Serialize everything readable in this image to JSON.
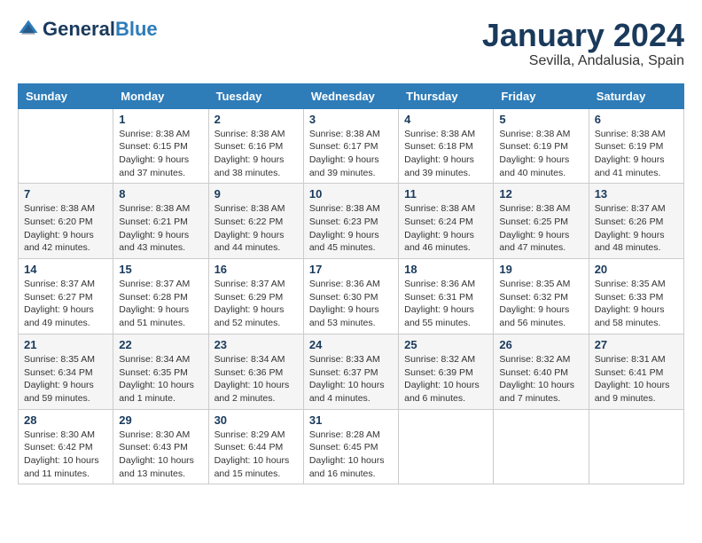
{
  "header": {
    "logo_general": "General",
    "logo_blue": "Blue",
    "month": "January 2024",
    "location": "Sevilla, Andalusia, Spain"
  },
  "days_of_week": [
    "Sunday",
    "Monday",
    "Tuesday",
    "Wednesday",
    "Thursday",
    "Friday",
    "Saturday"
  ],
  "weeks": [
    [
      {
        "day": "",
        "info": ""
      },
      {
        "day": "1",
        "info": "Sunrise: 8:38 AM\nSunset: 6:15 PM\nDaylight: 9 hours\nand 37 minutes."
      },
      {
        "day": "2",
        "info": "Sunrise: 8:38 AM\nSunset: 6:16 PM\nDaylight: 9 hours\nand 38 minutes."
      },
      {
        "day": "3",
        "info": "Sunrise: 8:38 AM\nSunset: 6:17 PM\nDaylight: 9 hours\nand 39 minutes."
      },
      {
        "day": "4",
        "info": "Sunrise: 8:38 AM\nSunset: 6:18 PM\nDaylight: 9 hours\nand 39 minutes."
      },
      {
        "day": "5",
        "info": "Sunrise: 8:38 AM\nSunset: 6:19 PM\nDaylight: 9 hours\nand 40 minutes."
      },
      {
        "day": "6",
        "info": "Sunrise: 8:38 AM\nSunset: 6:19 PM\nDaylight: 9 hours\nand 41 minutes."
      }
    ],
    [
      {
        "day": "7",
        "info": "Sunrise: 8:38 AM\nSunset: 6:20 PM\nDaylight: 9 hours\nand 42 minutes."
      },
      {
        "day": "8",
        "info": "Sunrise: 8:38 AM\nSunset: 6:21 PM\nDaylight: 9 hours\nand 43 minutes."
      },
      {
        "day": "9",
        "info": "Sunrise: 8:38 AM\nSunset: 6:22 PM\nDaylight: 9 hours\nand 44 minutes."
      },
      {
        "day": "10",
        "info": "Sunrise: 8:38 AM\nSunset: 6:23 PM\nDaylight: 9 hours\nand 45 minutes."
      },
      {
        "day": "11",
        "info": "Sunrise: 8:38 AM\nSunset: 6:24 PM\nDaylight: 9 hours\nand 46 minutes."
      },
      {
        "day": "12",
        "info": "Sunrise: 8:38 AM\nSunset: 6:25 PM\nDaylight: 9 hours\nand 47 minutes."
      },
      {
        "day": "13",
        "info": "Sunrise: 8:37 AM\nSunset: 6:26 PM\nDaylight: 9 hours\nand 48 minutes."
      }
    ],
    [
      {
        "day": "14",
        "info": "Sunrise: 8:37 AM\nSunset: 6:27 PM\nDaylight: 9 hours\nand 49 minutes."
      },
      {
        "day": "15",
        "info": "Sunrise: 8:37 AM\nSunset: 6:28 PM\nDaylight: 9 hours\nand 51 minutes."
      },
      {
        "day": "16",
        "info": "Sunrise: 8:37 AM\nSunset: 6:29 PM\nDaylight: 9 hours\nand 52 minutes."
      },
      {
        "day": "17",
        "info": "Sunrise: 8:36 AM\nSunset: 6:30 PM\nDaylight: 9 hours\nand 53 minutes."
      },
      {
        "day": "18",
        "info": "Sunrise: 8:36 AM\nSunset: 6:31 PM\nDaylight: 9 hours\nand 55 minutes."
      },
      {
        "day": "19",
        "info": "Sunrise: 8:35 AM\nSunset: 6:32 PM\nDaylight: 9 hours\nand 56 minutes."
      },
      {
        "day": "20",
        "info": "Sunrise: 8:35 AM\nSunset: 6:33 PM\nDaylight: 9 hours\nand 58 minutes."
      }
    ],
    [
      {
        "day": "21",
        "info": "Sunrise: 8:35 AM\nSunset: 6:34 PM\nDaylight: 9 hours\nand 59 minutes."
      },
      {
        "day": "22",
        "info": "Sunrise: 8:34 AM\nSunset: 6:35 PM\nDaylight: 10 hours\nand 1 minute."
      },
      {
        "day": "23",
        "info": "Sunrise: 8:34 AM\nSunset: 6:36 PM\nDaylight: 10 hours\nand 2 minutes."
      },
      {
        "day": "24",
        "info": "Sunrise: 8:33 AM\nSunset: 6:37 PM\nDaylight: 10 hours\nand 4 minutes."
      },
      {
        "day": "25",
        "info": "Sunrise: 8:32 AM\nSunset: 6:39 PM\nDaylight: 10 hours\nand 6 minutes."
      },
      {
        "day": "26",
        "info": "Sunrise: 8:32 AM\nSunset: 6:40 PM\nDaylight: 10 hours\nand 7 minutes."
      },
      {
        "day": "27",
        "info": "Sunrise: 8:31 AM\nSunset: 6:41 PM\nDaylight: 10 hours\nand 9 minutes."
      }
    ],
    [
      {
        "day": "28",
        "info": "Sunrise: 8:30 AM\nSunset: 6:42 PM\nDaylight: 10 hours\nand 11 minutes."
      },
      {
        "day": "29",
        "info": "Sunrise: 8:30 AM\nSunset: 6:43 PM\nDaylight: 10 hours\nand 13 minutes."
      },
      {
        "day": "30",
        "info": "Sunrise: 8:29 AM\nSunset: 6:44 PM\nDaylight: 10 hours\nand 15 minutes."
      },
      {
        "day": "31",
        "info": "Sunrise: 8:28 AM\nSunset: 6:45 PM\nDaylight: 10 hours\nand 16 minutes."
      },
      {
        "day": "",
        "info": ""
      },
      {
        "day": "",
        "info": ""
      },
      {
        "day": "",
        "info": ""
      }
    ]
  ]
}
